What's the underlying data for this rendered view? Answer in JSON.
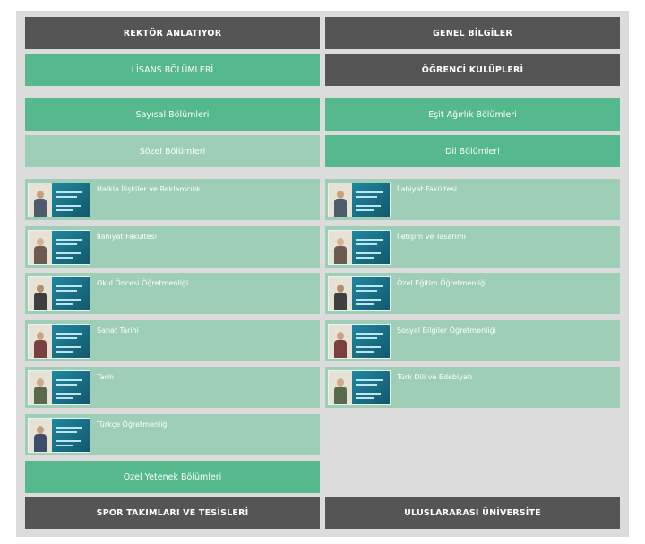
{
  "top_row": {
    "left": "REKTÖR ANLATIYOR",
    "right": "GENEL BİLGİLER"
  },
  "second_row": {
    "left": "LİSANS BÖLÜMLERİ",
    "right": "ÖĞRENCİ KULÜPLERİ"
  },
  "categories": {
    "sayisal": "Sayısal Bölümleri",
    "esit_agirlik": "Eşit Ağırlık Bölümleri",
    "sozel": "Sözel Bölümleri",
    "dil": "Dil Bölümleri"
  },
  "left_departments": [
    "Halkla İlişkiler ve Reklamcılık",
    "İlahiyat Fakültesi",
    "Okul Öncesi Öğretmenliği",
    "Sanat Tarihi",
    "Tarih",
    "Türkçe Öğretmenliği"
  ],
  "right_departments": [
    "İlahiyat Fakültesi",
    "İletişim ve Tasarımı",
    "Özel Eğitim Öğretmenliği",
    "Sosyal Bilgiler Öğretmenliği",
    "Türk Dili ve Edebiyatı"
  ],
  "ozel_yetenek": "Özel Yetenek Bölümleri",
  "bottom_row": {
    "left": "SPOR TAKIMLARI VE TESİSLERİ",
    "right": "ULUSLARARASI ÜNİVERSİTE"
  },
  "colors": {
    "dark_button": "#555555",
    "green_button": "#55b98d",
    "pale_green": "#9ecfb6",
    "frame_bg": "#dcdcdc"
  },
  "icons": {
    "thumbnail": "video-thumbnail-icon"
  }
}
